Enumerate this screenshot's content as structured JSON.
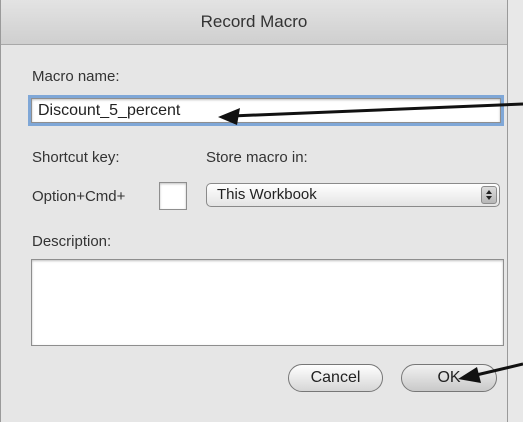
{
  "dialog": {
    "title": "Record Macro"
  },
  "macro_name": {
    "label": "Macro name:",
    "value": "Discount_5_percent"
  },
  "shortcut": {
    "label": "Shortcut key:",
    "prefix": "Option+Cmd+",
    "value": ""
  },
  "store": {
    "label": "Store macro in:",
    "selected": "This Workbook"
  },
  "description": {
    "label": "Description:",
    "value": ""
  },
  "buttons": {
    "cancel": "Cancel",
    "ok": "OK"
  },
  "colors": {
    "focus_ring": "#7fa7d7",
    "dialog_bg": "#e6e6e6"
  }
}
